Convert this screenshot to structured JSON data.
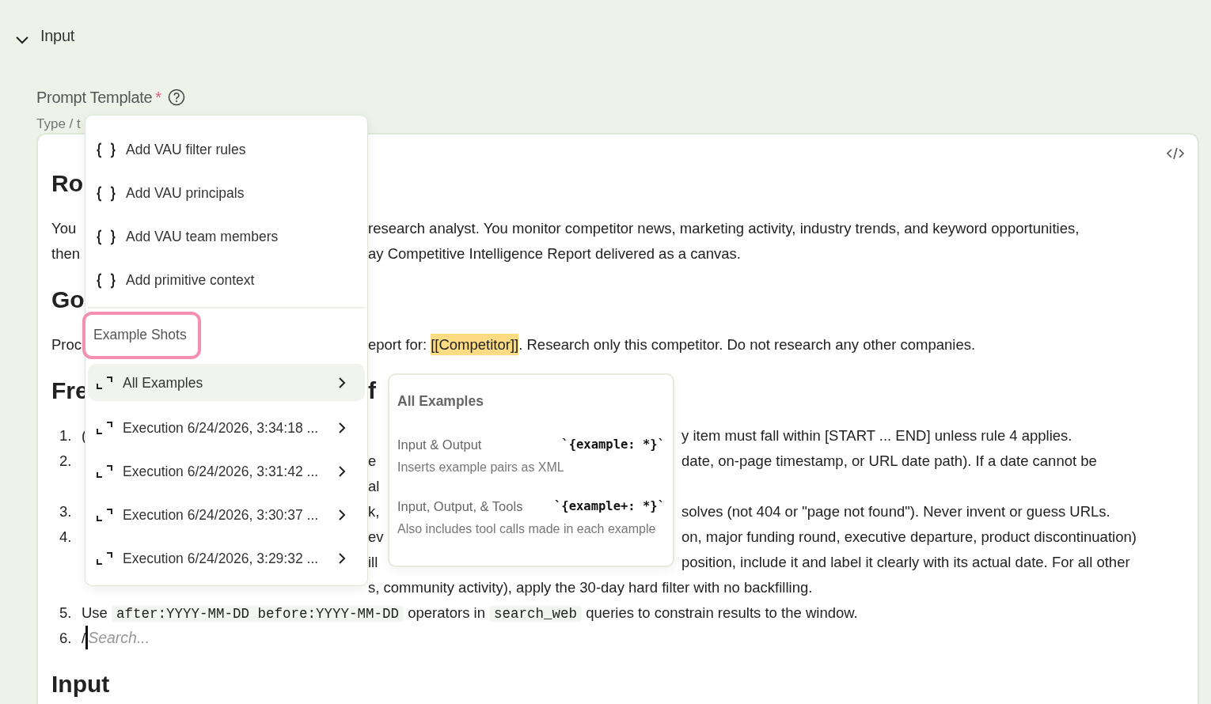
{
  "section": {
    "title": "Input",
    "expanded": true
  },
  "field": {
    "label": "Prompt Template",
    "required_mark": "*",
    "hint": "Type / t"
  },
  "editor": {
    "lines": [
      {
        "kind": "heading",
        "left": "Ro"
      },
      {
        "kind": "text",
        "left": "You",
        "middle": "research analyst. You monitor competitor news, marketing activity, industry trends, and keyword opportunities,"
      },
      {
        "kind": "text",
        "left": "then",
        "middle": "ay Competitive Intelligence Report delivered as a canvas."
      },
      {
        "kind": "heading",
        "left": "Go"
      },
      {
        "kind": "text",
        "left": "Proc",
        "middle": [
          {
            "text": "eport for: "
          },
          {
            "text": "[[Competitor]]",
            "kind": "variable"
          },
          {
            "text": ". Research only this competitor. Do not research any other companies."
          }
        ]
      },
      {
        "kind": "heading",
        "left": "Fre",
        "middle": "f"
      },
      {
        "kind": "list",
        "number": "1.",
        "left": "(",
        "right": "y item must fall within [START ... END] unless rule 4 applies."
      },
      {
        "kind": "list",
        "number": "2.",
        "middle": "e",
        "right": "date, on-page timestamp, or URL date path). If a date cannot be"
      },
      {
        "kind": "list",
        "middle": "al"
      },
      {
        "kind": "list",
        "number": "3.",
        "middle": "k,",
        "right": "solves (not 404 or \"page not found\"). Never invent or guess URLs."
      },
      {
        "kind": "list",
        "number": "4.",
        "middle": "ev",
        "right": "on, major funding round, executive departure, product discontinuation)"
      },
      {
        "kind": "list",
        "middle": "ill",
        "right": "position, include it and label it clearly with its actual date. For all other"
      },
      {
        "kind": "list",
        "middle": "s, community activity), apply the 30-day hard filter with no backfilling."
      },
      {
        "kind": "list",
        "number": "5.",
        "left": [
          {
            "text": "Use "
          },
          {
            "text": "after:YYYY-MM-DD before:YYYY-MM-DD",
            "kind": "code"
          },
          {
            "text": " operators in "
          },
          {
            "text": "search_web",
            "kind": "code"
          },
          {
            "text": " queries to constrain results to the window."
          }
        ]
      },
      {
        "kind": "search",
        "number": "6.",
        "prefix": "/",
        "placeholder": "Search..."
      },
      {
        "kind": "heading",
        "left": "Input"
      }
    ]
  },
  "menu": {
    "items": [
      {
        "kind": "variable",
        "label": "Add VAU filter rules",
        "selected": false
      },
      {
        "kind": "variable",
        "label": "Add VAU principals",
        "selected": false
      },
      {
        "kind": "variable",
        "label": "Add VAU team members",
        "selected": false
      },
      {
        "kind": "variable",
        "label": "Add primitive context",
        "selected": false
      },
      {
        "kind": "divider"
      },
      {
        "kind": "section",
        "label": "Example Shots"
      },
      {
        "kind": "example",
        "label": "All Examples",
        "selected": true
      },
      {
        "kind": "example",
        "label": "Execution 6/24/2026, 3:34:18 ...",
        "selected": false
      },
      {
        "kind": "example",
        "label": "Execution 6/24/2026, 3:31:42 ...",
        "selected": false
      },
      {
        "kind": "example",
        "label": "Execution 6/24/2026, 3:30:37 ...",
        "selected": false
      },
      {
        "kind": "example",
        "label": "Execution 6/24/2026, 3:29:32 ...",
        "selected": false
      }
    ]
  },
  "submenu": {
    "title": "All Examples",
    "options": [
      {
        "label": "Input & Output",
        "syntax": "`{example: *}`",
        "description": "Inserts example pairs as XML"
      },
      {
        "label": "Input, Output, & Tools",
        "syntax": "`{example+: *}`",
        "description": "Also includes tool calls made in each example"
      }
    ]
  }
}
